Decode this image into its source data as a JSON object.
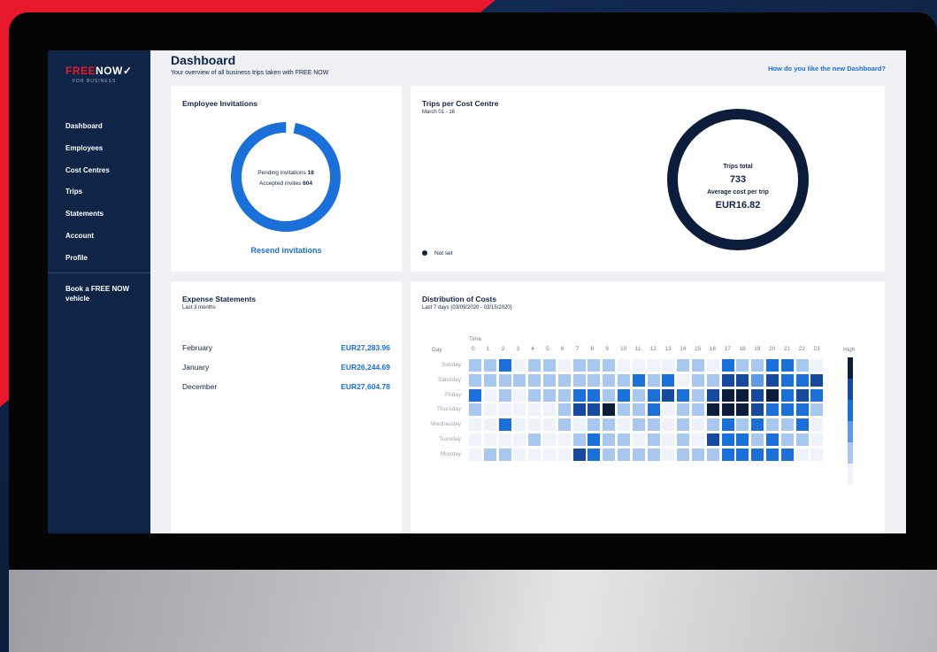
{
  "brand": {
    "logo_free": "FREE",
    "logo_now": "NOW",
    "logo_sub": "FOR BUSINESS",
    "accent": "#1a6fd8",
    "navy": "#0f2548"
  },
  "sidebar": {
    "items": [
      "Dashboard",
      "Employees",
      "Cost Centres",
      "Trips",
      "Statements",
      "Account",
      "Profile"
    ],
    "book": "Book a FREE NOW vehicle"
  },
  "header": {
    "title": "Dashboard",
    "subtitle": "Your overview of all business trips taken with FREE NOW",
    "feedback": "How do you like the new Dashboard?"
  },
  "invitations": {
    "title": "Employee Invitations",
    "pending_label": "Pending invitations",
    "pending": "18",
    "accepted_label": "Accepted invites",
    "accepted": "604",
    "resend": "Resend invitations"
  },
  "trips": {
    "title": "Trips per Cost Centre",
    "subtitle": "March 01 - 16",
    "total_label": "Trips total",
    "total": "733",
    "avg_label": "Average cost per trip",
    "avg": "EUR16.82",
    "legend": "Not set"
  },
  "statements": {
    "title": "Expense Statements",
    "subtitle": "Last 3 months",
    "rows": [
      {
        "month": "February",
        "amount": "EUR27,283.96"
      },
      {
        "month": "January",
        "amount": "EUR26,244.69"
      },
      {
        "month": "December",
        "amount": "EUR27,604.78"
      }
    ]
  },
  "distribution": {
    "title": "Distribution of Costs",
    "subtitle": "Last 7 days (03/09/2020 - 03/15/2020)",
    "time_label": "Time",
    "day_label": "Day",
    "high_label": "High",
    "hours": [
      "0",
      "1",
      "2",
      "3",
      "4",
      "5",
      "6",
      "7",
      "8",
      "9",
      "10",
      "11",
      "12",
      "13",
      "14",
      "15",
      "16",
      "17",
      "18",
      "19",
      "20",
      "21",
      "22",
      "23"
    ],
    "days": [
      "Sunday",
      "Saturday",
      "Friday",
      "Thursday",
      "Wednesday",
      "Tuesday",
      "Monday"
    ],
    "palette": [
      "#eef3fb",
      "#a9c8ef",
      "#5d9be6",
      "#1a6fd8",
      "#154a9e",
      "#0b1d3a"
    ],
    "levels": [
      [
        1,
        1,
        3,
        0,
        1,
        1,
        0,
        1,
        1,
        1,
        0,
        0,
        0,
        0,
        1,
        1,
        0,
        3,
        1,
        1,
        3,
        3,
        1,
        0
      ],
      [
        1,
        1,
        1,
        1,
        1,
        1,
        1,
        1,
        1,
        1,
        1,
        3,
        1,
        3,
        0,
        1,
        1,
        4,
        4,
        2,
        4,
        3,
        3,
        4
      ],
      [
        3,
        0,
        1,
        0,
        1,
        1,
        1,
        3,
        3,
        1,
        3,
        1,
        3,
        4,
        3,
        1,
        4,
        5,
        5,
        4,
        5,
        3,
        4,
        3
      ],
      [
        1,
        0,
        0,
        0,
        0,
        0,
        1,
        4,
        4,
        5,
        1,
        1,
        3,
        0,
        1,
        1,
        5,
        5,
        5,
        4,
        3,
        3,
        3,
        1
      ],
      [
        0,
        0,
        3,
        0,
        0,
        0,
        1,
        0,
        1,
        1,
        0,
        1,
        1,
        0,
        1,
        0,
        1,
        3,
        1,
        3,
        1,
        1,
        3,
        0
      ],
      [
        0,
        0,
        0,
        0,
        1,
        0,
        0,
        1,
        3,
        1,
        1,
        0,
        1,
        0,
        1,
        0,
        4,
        3,
        3,
        1,
        3,
        1,
        1,
        0
      ],
      [
        0,
        1,
        1,
        0,
        0,
        0,
        0,
        4,
        3,
        1,
        1,
        1,
        1,
        0,
        1,
        1,
        1,
        3,
        3,
        3,
        3,
        3,
        0,
        0
      ]
    ]
  }
}
